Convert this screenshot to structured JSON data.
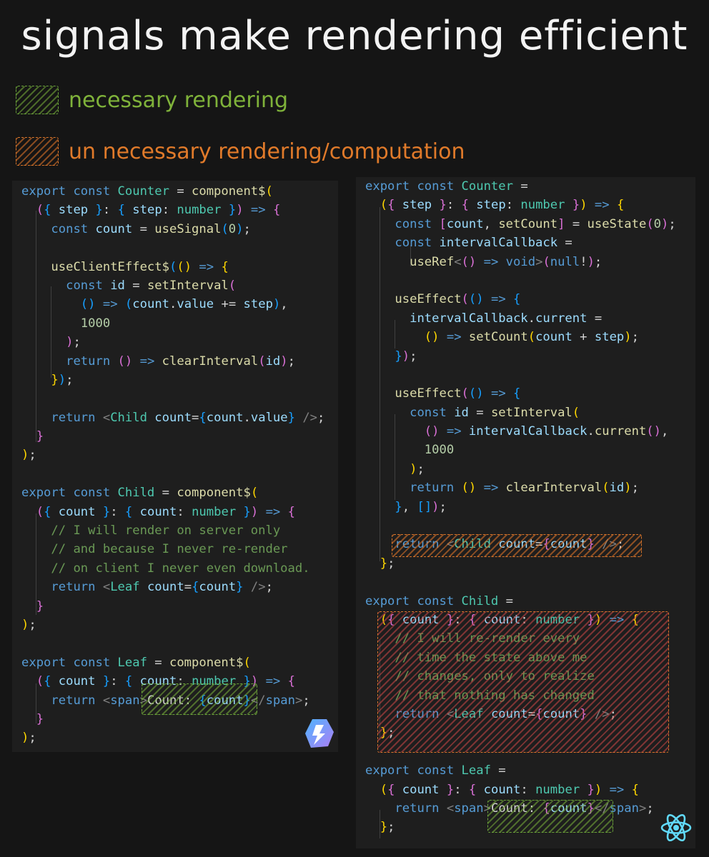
{
  "title": "signals make rendering efficient",
  "legend": [
    {
      "label": "necessary rendering",
      "color": "#7fb23a"
    },
    {
      "label": "un necessary rendering/computation",
      "color": "#e07a2a"
    }
  ],
  "qwik_logo": "qwik-logo-icon",
  "react_logo": "react-logo-icon",
  "left_code": [
    [
      [
        "kw",
        "export "
      ],
      [
        "kw",
        "const "
      ],
      [
        "ty",
        "Counter"
      ],
      [
        "",
        "  = "
      ],
      [
        "fn",
        "component$"
      ],
      [
        "br1",
        "("
      ]
    ],
    [
      [
        "",
        "  "
      ],
      [
        "br2",
        "("
      ],
      [
        "br3",
        "{ "
      ],
      [
        "id",
        "step "
      ],
      [
        "br3",
        "}"
      ],
      [
        "",
        ": "
      ],
      [
        "br3",
        "{ "
      ],
      [
        "id",
        "step"
      ],
      [
        "",
        ": "
      ],
      [
        "ty",
        "number "
      ],
      [
        "br3",
        "}"
      ],
      [
        "br2",
        ")"
      ],
      [
        "kw",
        " => "
      ],
      [
        "br2",
        "{"
      ]
    ],
    [
      [
        "",
        "    "
      ],
      [
        "kw",
        "const "
      ],
      [
        "id",
        "count "
      ],
      [
        "",
        "= "
      ],
      [
        "fn",
        "useSignal"
      ],
      [
        "br3",
        "("
      ],
      [
        "num",
        "0"
      ],
      [
        "br3",
        ")"
      ],
      [
        "",
        ";"
      ]
    ],
    [
      [
        "",
        ""
      ]
    ],
    [
      [
        "",
        "    "
      ],
      [
        "fn",
        "useClientEffect$"
      ],
      [
        "br3",
        "("
      ],
      [
        "br1",
        "("
      ],
      [
        "br1",
        ")"
      ],
      [
        "kw",
        " => "
      ],
      [
        "br1",
        "{"
      ]
    ],
    [
      [
        "",
        "      "
      ],
      [
        "kw",
        "const "
      ],
      [
        "id",
        "id "
      ],
      [
        "",
        "= "
      ],
      [
        "fn",
        "setInterval"
      ],
      [
        "br2",
        "("
      ]
    ],
    [
      [
        "",
        "        "
      ],
      [
        "br3",
        "("
      ],
      [
        "br3",
        ")"
      ],
      [
        "kw",
        " => "
      ],
      [
        "br3",
        "("
      ],
      [
        "id",
        "count"
      ],
      [
        "",
        ". "
      ],
      [
        "id",
        "value "
      ],
      [
        "",
        "+= "
      ],
      [
        "id",
        "step"
      ],
      [
        "br3",
        ")"
      ],
      [
        "",
        ","
      ]
    ],
    [
      [
        "",
        "        "
      ],
      [
        "num",
        "1000"
      ]
    ],
    [
      [
        "",
        "      "
      ],
      [
        "br2",
        ")"
      ],
      [
        "",
        ";"
      ]
    ],
    [
      [
        "",
        "      "
      ],
      [
        "kw",
        "return "
      ],
      [
        "br2",
        "("
      ],
      [
        "br2",
        ")"
      ],
      [
        "kw",
        " => "
      ],
      [
        "fn",
        "clearInterval"
      ],
      [
        "br2",
        "("
      ],
      [
        "id",
        "id"
      ],
      [
        "br2",
        ")"
      ],
      [
        "",
        ";"
      ]
    ],
    [
      [
        "",
        "    "
      ],
      [
        "br1",
        "}"
      ],
      [
        "br3",
        ")"
      ],
      [
        "",
        ";"
      ]
    ],
    [
      [
        "",
        ""
      ]
    ],
    [
      [
        "",
        "    "
      ],
      [
        "kw",
        "return "
      ],
      [
        "tag",
        "<"
      ],
      [
        "ty",
        "Child "
      ],
      [
        "id",
        "count"
      ],
      [
        "",
        "="
      ],
      [
        "br3",
        "{"
      ],
      [
        "id",
        "count"
      ],
      [
        "",
        "."
      ],
      [
        "id",
        "value"
      ],
      [
        "br3",
        "}"
      ],
      [
        "tag",
        " />"
      ],
      [
        "",
        ";"
      ]
    ],
    [
      [
        "",
        "  "
      ],
      [
        "br2",
        "}"
      ]
    ],
    [
      [
        "br1",
        ")"
      ],
      [
        "",
        ";"
      ]
    ],
    [
      [
        "",
        ""
      ]
    ],
    [
      [
        "kw",
        "export "
      ],
      [
        "kw",
        "const "
      ],
      [
        "ty",
        "Child "
      ],
      [
        "",
        "= "
      ],
      [
        "fn",
        "component$"
      ],
      [
        "br1",
        "("
      ]
    ],
    [
      [
        "",
        "  "
      ],
      [
        "br2",
        "("
      ],
      [
        "br3",
        "{ "
      ],
      [
        "id",
        "count "
      ],
      [
        "br3",
        "}"
      ],
      [
        "",
        ": "
      ],
      [
        "br3",
        "{ "
      ],
      [
        "id",
        "count"
      ],
      [
        "",
        ": "
      ],
      [
        "ty",
        "number "
      ],
      [
        "br3",
        "}"
      ],
      [
        "br2",
        ")"
      ],
      [
        "kw",
        " => "
      ],
      [
        "br2",
        "{"
      ]
    ],
    [
      [
        "",
        "    "
      ],
      [
        "cm",
        "// I will render on server only"
      ]
    ],
    [
      [
        "",
        "    "
      ],
      [
        "cm",
        "// and because I never re-render"
      ]
    ],
    [
      [
        "",
        "    "
      ],
      [
        "cm",
        "// on client I never even download."
      ]
    ],
    [
      [
        "",
        "    "
      ],
      [
        "kw",
        "return "
      ],
      [
        "tag",
        "<"
      ],
      [
        "ty",
        "Leaf "
      ],
      [
        "id",
        "count"
      ],
      [
        "",
        "="
      ],
      [
        "br3",
        "{"
      ],
      [
        "id",
        "count"
      ],
      [
        "br3",
        "}"
      ],
      [
        "tag",
        " />"
      ],
      [
        "",
        ";"
      ]
    ],
    [
      [
        "",
        "  "
      ],
      [
        "br2",
        "}"
      ]
    ],
    [
      [
        "br1",
        ")"
      ],
      [
        "",
        ";"
      ]
    ],
    [
      [
        "",
        ""
      ]
    ],
    [
      [
        "kw",
        "export "
      ],
      [
        "kw",
        "const "
      ],
      [
        "ty",
        "Leaf "
      ],
      [
        "",
        "= "
      ],
      [
        "fn",
        "component$"
      ],
      [
        "br1",
        "("
      ]
    ],
    [
      [
        "",
        "  "
      ],
      [
        "br2",
        "("
      ],
      [
        "br3",
        "{ "
      ],
      [
        "id",
        "count "
      ],
      [
        "br3",
        "}"
      ],
      [
        "",
        ": "
      ],
      [
        "br3",
        "{ "
      ],
      [
        "id",
        "count"
      ],
      [
        "",
        ": "
      ],
      [
        "ty",
        "number "
      ],
      [
        "br3",
        "}"
      ],
      [
        "br2",
        ")"
      ],
      [
        "kw",
        " => "
      ],
      [
        "br2",
        "{"
      ]
    ],
    [
      [
        "",
        "    "
      ],
      [
        "kw",
        "return "
      ],
      [
        "tag",
        "<"
      ],
      [
        "kw",
        "span"
      ],
      [
        "tag",
        ">"
      ],
      [
        "",
        "Count: "
      ],
      [
        "br3",
        "{"
      ],
      [
        "id",
        "count"
      ],
      [
        "br3",
        "}"
      ],
      [
        "tag",
        "</"
      ],
      [
        "kw",
        "span"
      ],
      [
        "tag",
        ">"
      ],
      [
        "",
        ";"
      ]
    ],
    [
      [
        "",
        "  "
      ],
      [
        "br2",
        "}"
      ]
    ],
    [
      [
        "br1",
        ")"
      ],
      [
        "",
        ";"
      ]
    ]
  ],
  "right_code": [
    [
      [
        "kw",
        "export "
      ],
      [
        "kw",
        "const "
      ],
      [
        "ty",
        "Counter "
      ],
      [
        "",
        "="
      ]
    ],
    [
      [
        "",
        "  "
      ],
      [
        "br1",
        "("
      ],
      [
        "br2",
        "{ "
      ],
      [
        "id",
        "step "
      ],
      [
        "br2",
        "}"
      ],
      [
        "",
        ": "
      ],
      [
        "br2",
        "{ "
      ],
      [
        "id",
        "step"
      ],
      [
        "",
        ": "
      ],
      [
        "ty",
        "number "
      ],
      [
        "br2",
        "}"
      ],
      [
        "br1",
        ")"
      ],
      [
        "kw",
        " => "
      ],
      [
        "br1",
        "{"
      ]
    ],
    [
      [
        "",
        "    "
      ],
      [
        "kw",
        "const "
      ],
      [
        "br2",
        "["
      ],
      [
        "id",
        "count"
      ],
      [
        "",
        ", "
      ],
      [
        "fn",
        "setCount"
      ],
      [
        "br2",
        "]"
      ],
      [
        "",
        " = "
      ],
      [
        "fn",
        "useState"
      ],
      [
        "br2",
        "("
      ],
      [
        "num",
        "0"
      ],
      [
        "br2",
        ")"
      ],
      [
        "",
        ";"
      ]
    ],
    [
      [
        "",
        "    "
      ],
      [
        "kw",
        "const "
      ],
      [
        "id",
        "intervalCallback "
      ],
      [
        "",
        "="
      ]
    ],
    [
      [
        "",
        "      "
      ],
      [
        "fn",
        "useRef"
      ],
      [
        "tag",
        "<"
      ],
      [
        "br2",
        "("
      ],
      [
        "br2",
        ")"
      ],
      [
        "kw",
        " => "
      ],
      [
        "kw",
        "void"
      ],
      [
        "tag",
        ">"
      ],
      [
        "br2",
        "("
      ],
      [
        "kw",
        "null"
      ],
      [
        "",
        "!"
      ],
      [
        "br2",
        ")"
      ],
      [
        "",
        ";"
      ]
    ],
    [
      [
        "",
        ""
      ]
    ],
    [
      [
        "",
        "    "
      ],
      [
        "fn",
        "useEffect"
      ],
      [
        "br2",
        "("
      ],
      [
        "br3",
        "("
      ],
      [
        "br3",
        ")"
      ],
      [
        "kw",
        " => "
      ],
      [
        "br3",
        "{"
      ]
    ],
    [
      [
        "",
        "      "
      ],
      [
        "id",
        "intervalCallback"
      ],
      [
        "",
        "."
      ],
      [
        "id",
        "current "
      ],
      [
        "",
        "="
      ]
    ],
    [
      [
        "",
        "        "
      ],
      [
        "br1",
        "("
      ],
      [
        "br1",
        ")"
      ],
      [
        "kw",
        " => "
      ],
      [
        "fn",
        "setCount"
      ],
      [
        "br1",
        "("
      ],
      [
        "id",
        "count "
      ],
      [
        "",
        "+ "
      ],
      [
        "id",
        "step"
      ],
      [
        "br1",
        ")"
      ],
      [
        "",
        ";"
      ]
    ],
    [
      [
        "",
        "    "
      ],
      [
        "br3",
        "}"
      ],
      [
        "br2",
        ")"
      ],
      [
        "",
        ";"
      ]
    ],
    [
      [
        "",
        ""
      ]
    ],
    [
      [
        "",
        "    "
      ],
      [
        "fn",
        "useEffect"
      ],
      [
        "br2",
        "("
      ],
      [
        "br3",
        "("
      ],
      [
        "br3",
        ")"
      ],
      [
        "kw",
        " => "
      ],
      [
        "br3",
        "{"
      ]
    ],
    [
      [
        "",
        "      "
      ],
      [
        "kw",
        "const "
      ],
      [
        "id",
        "id "
      ],
      [
        "",
        "= "
      ],
      [
        "fn",
        "setInterval"
      ],
      [
        "br1",
        "("
      ]
    ],
    [
      [
        "",
        "        "
      ],
      [
        "br2",
        "("
      ],
      [
        "br2",
        ")"
      ],
      [
        "kw",
        " => "
      ],
      [
        "id",
        "intervalCallback"
      ],
      [
        "",
        "."
      ],
      [
        "fn",
        "current"
      ],
      [
        "br2",
        "("
      ],
      [
        "br2",
        ")"
      ],
      [
        "",
        ","
      ]
    ],
    [
      [
        "",
        "        "
      ],
      [
        "num",
        "1000"
      ]
    ],
    [
      [
        "",
        "      "
      ],
      [
        "br1",
        ")"
      ],
      [
        "",
        ";"
      ]
    ],
    [
      [
        "",
        "      "
      ],
      [
        "kw",
        "return "
      ],
      [
        "br1",
        "("
      ],
      [
        "br1",
        ")"
      ],
      [
        "kw",
        " => "
      ],
      [
        "fn",
        "clearInterval"
      ],
      [
        "br1",
        "("
      ],
      [
        "id",
        "id"
      ],
      [
        "br1",
        ")"
      ],
      [
        "",
        ";"
      ]
    ],
    [
      [
        "",
        "    "
      ],
      [
        "br3",
        "}"
      ],
      [
        "",
        ", "
      ],
      [
        "br3",
        "[]"
      ],
      [
        "br2",
        ")"
      ],
      [
        "",
        ";"
      ]
    ],
    [
      [
        "",
        ""
      ]
    ],
    [
      [
        "",
        "    "
      ],
      [
        "kw",
        "return "
      ],
      [
        "tag",
        "<"
      ],
      [
        "ty",
        "Child "
      ],
      [
        "id",
        "count"
      ],
      [
        "",
        "="
      ],
      [
        "br2",
        "{"
      ],
      [
        "id",
        "count"
      ],
      [
        "br2",
        "}"
      ],
      [
        "tag",
        " />"
      ],
      [
        "",
        ";"
      ]
    ],
    [
      [
        "",
        "  "
      ],
      [
        "br1",
        "}"
      ],
      [
        "",
        ";"
      ]
    ],
    [
      [
        "",
        ""
      ]
    ],
    [
      [
        "kw",
        "export "
      ],
      [
        "kw",
        "const "
      ],
      [
        "ty",
        "Child "
      ],
      [
        "",
        "="
      ]
    ],
    [
      [
        "",
        "  "
      ],
      [
        "br1",
        "("
      ],
      [
        "br2",
        "{ "
      ],
      [
        "id",
        "count "
      ],
      [
        "br2",
        "}"
      ],
      [
        "",
        ": "
      ],
      [
        "br2",
        "{ "
      ],
      [
        "id",
        "count"
      ],
      [
        "",
        ": "
      ],
      [
        "ty",
        "number "
      ],
      [
        "br2",
        "}"
      ],
      [
        "br1",
        ")"
      ],
      [
        "kw",
        " => "
      ],
      [
        "br1",
        "{"
      ]
    ],
    [
      [
        "",
        "    "
      ],
      [
        "cm",
        "// I will re-render every"
      ]
    ],
    [
      [
        "",
        "    "
      ],
      [
        "cm",
        "// time the state above me"
      ]
    ],
    [
      [
        "",
        "    "
      ],
      [
        "cm",
        "// changes, only to realize"
      ]
    ],
    [
      [
        "",
        "    "
      ],
      [
        "cm",
        "// that nothing has changed"
      ]
    ],
    [
      [
        "",
        "    "
      ],
      [
        "kw",
        "return "
      ],
      [
        "tag",
        "<"
      ],
      [
        "ty",
        "Leaf "
      ],
      [
        "id",
        "count"
      ],
      [
        "",
        "="
      ],
      [
        "br2",
        "{"
      ],
      [
        "id",
        "count"
      ],
      [
        "br2",
        "}"
      ],
      [
        "tag",
        " />"
      ],
      [
        "",
        ";"
      ]
    ],
    [
      [
        "",
        "  "
      ],
      [
        "br1",
        "}"
      ],
      [
        "",
        ";"
      ]
    ],
    [
      [
        "",
        ""
      ]
    ],
    [
      [
        "kw",
        "export "
      ],
      [
        "kw",
        "const "
      ],
      [
        "ty",
        "Leaf "
      ],
      [
        "",
        "="
      ]
    ],
    [
      [
        "",
        "  "
      ],
      [
        "br1",
        "("
      ],
      [
        "br2",
        "{ "
      ],
      [
        "id",
        "count "
      ],
      [
        "br2",
        "}"
      ],
      [
        "",
        ": "
      ],
      [
        "br2",
        "{ "
      ],
      [
        "id",
        "count"
      ],
      [
        "",
        ": "
      ],
      [
        "ty",
        "number "
      ],
      [
        "br2",
        "}"
      ],
      [
        "br1",
        ")"
      ],
      [
        "kw",
        " => "
      ],
      [
        "br1",
        "{"
      ]
    ],
    [
      [
        "",
        "    "
      ],
      [
        "kw",
        "return "
      ],
      [
        "tag",
        "<"
      ],
      [
        "kw",
        "span"
      ],
      [
        "tag",
        ">"
      ],
      [
        "",
        "Count: "
      ],
      [
        "br2",
        "{"
      ],
      [
        "id",
        "count"
      ],
      [
        "br2",
        "}"
      ],
      [
        "tag",
        "</"
      ],
      [
        "kw",
        "span"
      ],
      [
        "tag",
        ">"
      ],
      [
        "",
        ";"
      ]
    ],
    [
      [
        "",
        "  "
      ],
      [
        "br1",
        "}"
      ],
      [
        "",
        ";"
      ]
    ]
  ]
}
